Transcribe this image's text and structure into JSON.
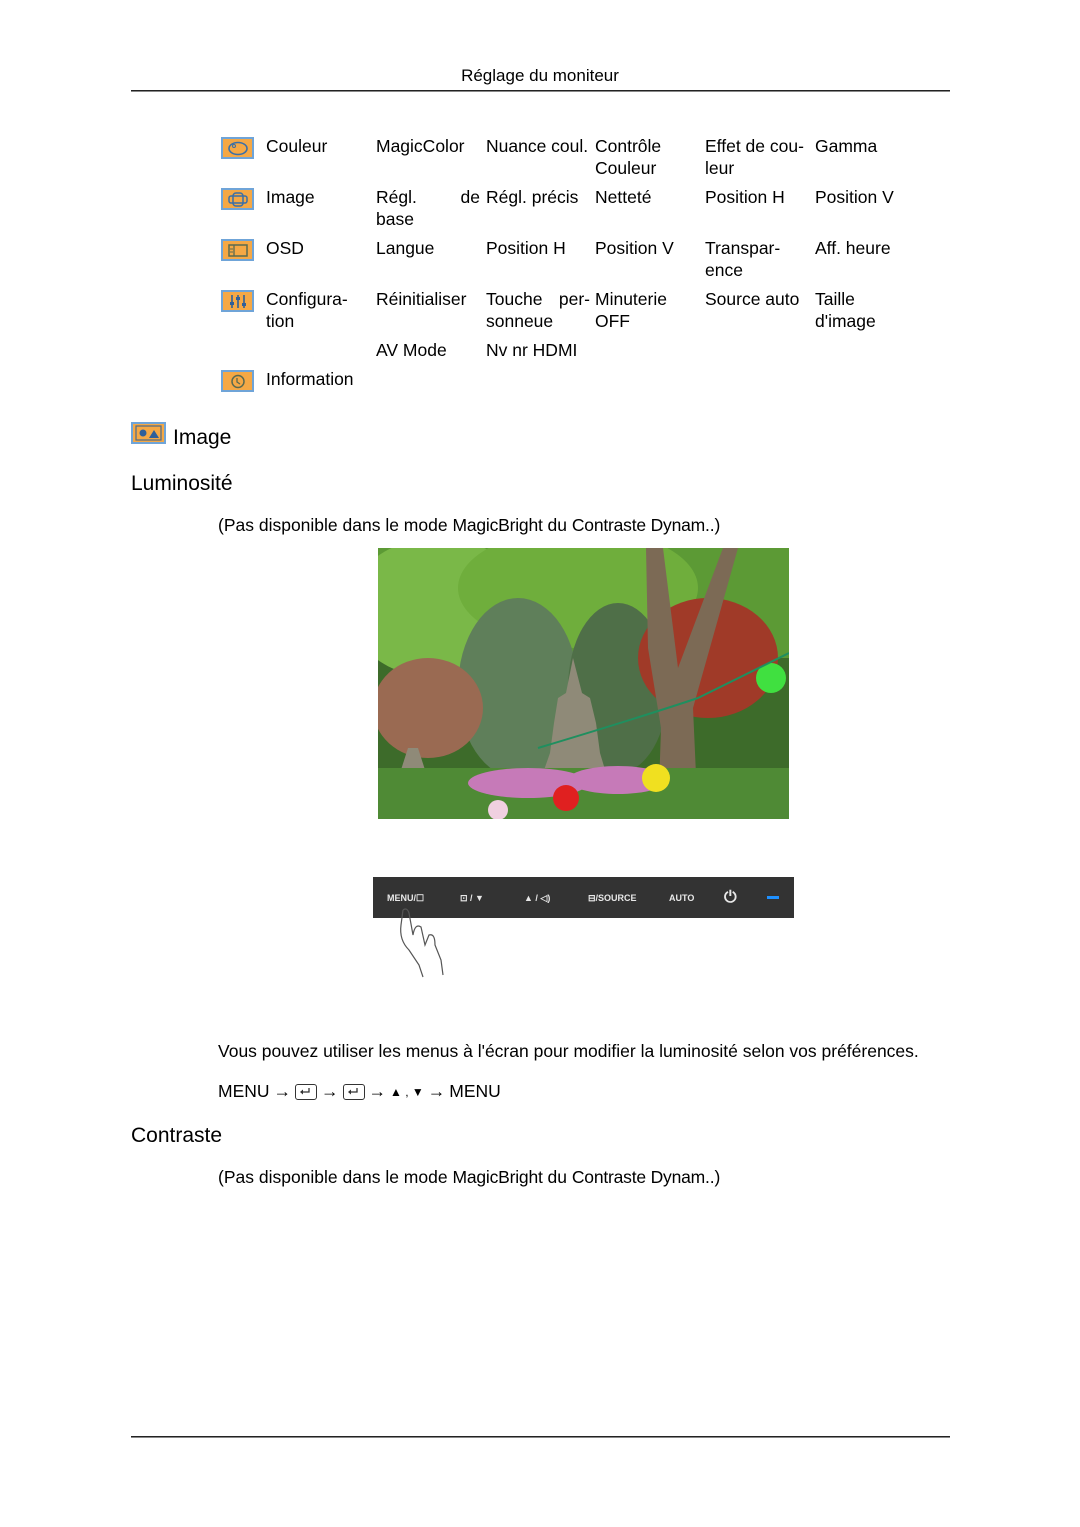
{
  "header": {
    "title": "Réglage du moniteur"
  },
  "menu_table": {
    "rows": [
      {
        "icon": "color-palette-icon",
        "cells": [
          "Couleur",
          "MagicColor",
          "Nuance coul.",
          "Contrôle Couleur",
          "Effet de cou- leur",
          "Gamma"
        ]
      },
      {
        "icon": "image-adjust-icon",
        "cells": [
          "Image",
          "Régl. de base",
          "Régl. précis",
          "Netteté",
          "Position H",
          "Position V"
        ]
      },
      {
        "icon": "osd-icon",
        "cells": [
          "OSD",
          "Langue",
          "Position H",
          "Position V",
          "Transpar- ence",
          "Aff. heure"
        ]
      },
      {
        "icon": "setup-sliders-icon",
        "cells": [
          "Configura- tion",
          "Réinitialiser",
          "Touche per- sonneue",
          "Minuterie OFF",
          "Source auto",
          "Taille d'image"
        ]
      },
      {
        "icon": null,
        "cells": [
          "",
          "AV Mode",
          "Nv nr HDMI",
          "",
          "",
          ""
        ]
      },
      {
        "icon": "information-clock-icon",
        "cells": [
          "Information",
          "",
          "",
          "",
          "",
          ""
        ]
      }
    ]
  },
  "section": {
    "title": "Image",
    "icon": "image-section-icon"
  },
  "luminosite": {
    "heading": "Luminosité",
    "note_prefix": "(Pas disponible dans le mode ",
    "note_bold1": "MagicBright",
    "note_mid": " du ",
    "note_bold2": "Contraste Dynam.",
    "note_suffix": ".)",
    "photo_alt": "Garden with stone pagodas and lanterns",
    "panel": {
      "buttons": [
        "MENU/☐",
        "⊡ / ▼",
        "▲ / ◁)",
        "⊟/SOURCE",
        "AUTO",
        "⏻",
        "—"
      ],
      "indicator_color": "#1e90ff"
    },
    "description": "Vous pouvez utiliser les menus à l'écran pour modifier la luminosité selon vos préférences.",
    "path": [
      "MENU",
      "→",
      "enter-key",
      "→",
      "enter-key",
      "→",
      "▲ , ▼",
      "→",
      "MENU"
    ]
  },
  "contraste": {
    "heading": "Contraste",
    "note_prefix": "(Pas disponible dans le mode ",
    "note_bold1": "MagicBright",
    "note_mid": " du ",
    "note_bold2": "Contraste Dynam.",
    "note_suffix": ".)"
  }
}
